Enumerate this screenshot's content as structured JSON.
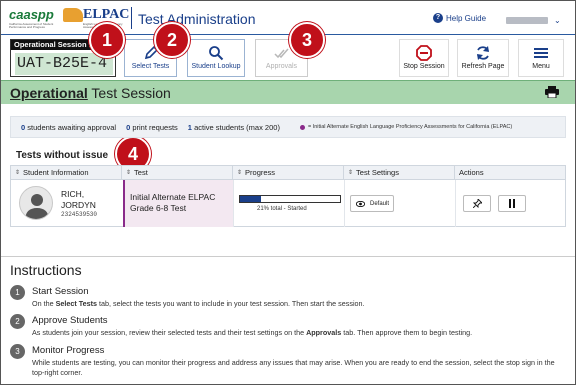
{
  "header": {
    "caaspp_logo": "caaspp",
    "caaspp_tagline": "California Assessment of Student Performance and Progress",
    "elpac_logo": "ELPAC",
    "elpac_tagline": "English Language Proficiency Assessments for California",
    "app_title": "Test Administration",
    "help_label": "Help Guide",
    "help_icon": "question-circle-icon",
    "user_menu_chevron": "chevron-down-icon"
  },
  "toolbar": {
    "session_label": "Operational Session ID",
    "session_id": "UAT-B25E-4",
    "select_tests": "Select Tests",
    "student_lookup": "Student Lookup",
    "approvals": "Approvals",
    "stop_session": "Stop Session",
    "refresh_page": "Refresh Page",
    "menu": "Menu"
  },
  "callouts": [
    "1",
    "2",
    "3",
    "4"
  ],
  "session_bar": {
    "title_bold": "Operational",
    "title_rest": " Test Session",
    "print_icon": "printer-icon"
  },
  "status": {
    "awaiting_count": "0",
    "awaiting_label": "students awaiting approval",
    "print_count": "0",
    "print_label": "print requests",
    "active_count": "1",
    "active_label": "active students (max 200)",
    "legend_text": "= Initial Alternate English Language Proficiency Assessments for California (ELPAC)",
    "legend_color": "#8a2a8a"
  },
  "tests_heading": "Tests without issue",
  "table": {
    "columns": [
      "Student Information",
      "Test",
      "Progress",
      "Test Settings",
      "Actions"
    ],
    "row": {
      "name_line1": "RICH,",
      "name_line2": "JORDYN",
      "ssid": "2324539530",
      "test_line1": "Initial Alternate ELPAC",
      "test_line2": "Grade 6-8 Test",
      "progress_percent": 21,
      "progress_text": "21% total  -  Started",
      "settings_label": "Default",
      "settings_icon": "eye-icon",
      "action_icons": [
        "pin-icon",
        "pause-icon"
      ]
    }
  },
  "instructions": {
    "title": "Instructions",
    "steps": [
      {
        "num": "1",
        "title": "Start Session",
        "text_a": "On the ",
        "text_b": "Select Tests",
        "text_c": " tab, select the tests you want to include in your test session. Then start the session."
      },
      {
        "num": "2",
        "title": "Approve Students",
        "text_a": "As students join your session, review their selected tests and their test settings on the ",
        "text_b": "Approvals",
        "text_c": " tab. Then approve them to begin testing."
      },
      {
        "num": "3",
        "title": "Monitor Progress",
        "text_a": "While students are testing, you can monitor their progress and address any issues that may arise. When you are ready to end the session, select the stop sign in the top-right corner.",
        "text_b": "",
        "text_c": ""
      }
    ]
  },
  "colors": {
    "brand_blue": "#1a3f8a",
    "session_green": "#a8d5ad",
    "callout_red": "#c0101a"
  }
}
